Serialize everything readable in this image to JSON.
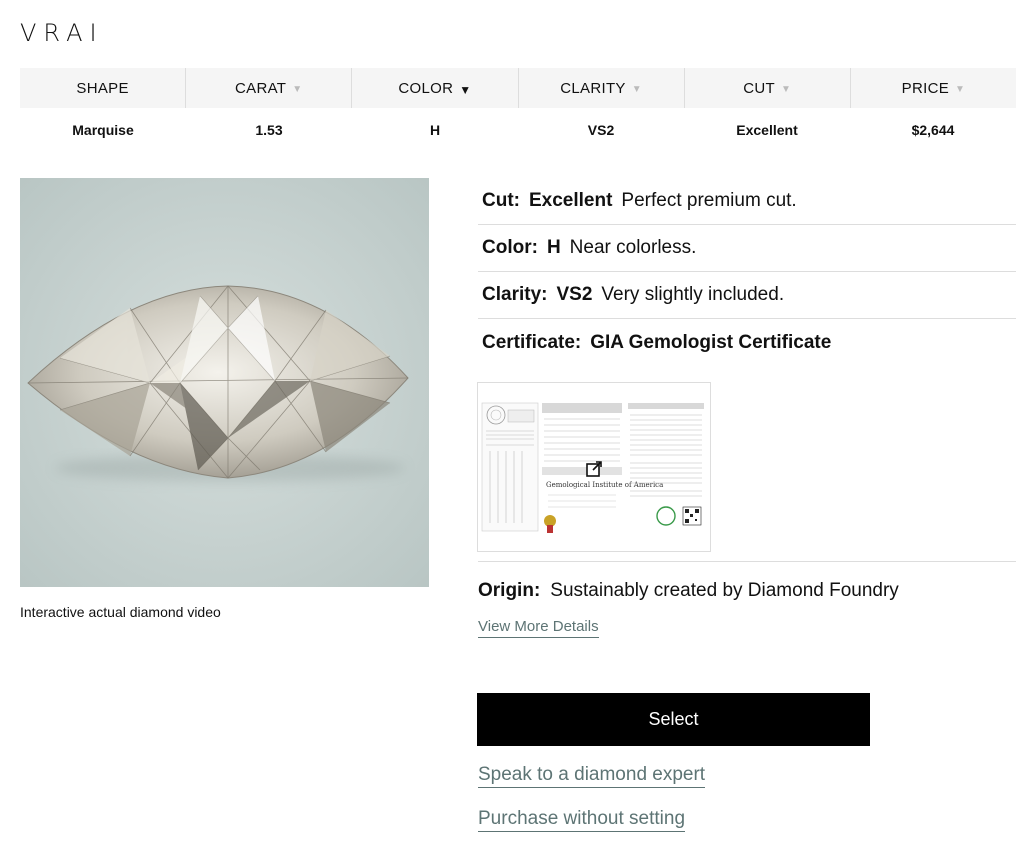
{
  "brand": {
    "logo_text": "VRAI"
  },
  "filters": {
    "headers": [
      {
        "label": "SHAPE",
        "arrow": "",
        "active": false
      },
      {
        "label": "CARAT",
        "arrow": "▼",
        "active": false
      },
      {
        "label": "COLOR",
        "arrow": "▼",
        "active": true
      },
      {
        "label": "CLARITY",
        "arrow": "▼",
        "active": false
      },
      {
        "label": "CUT",
        "arrow": "▼",
        "active": false
      },
      {
        "label": "PRICE",
        "arrow": "▼",
        "active": false
      }
    ]
  },
  "diamond_row": {
    "shape": "Marquise",
    "carat": "1.53",
    "color": "H",
    "clarity": "VS2",
    "cut": "Excellent",
    "price": "$2,644"
  },
  "media": {
    "caption": "Interactive actual diamond video"
  },
  "specs": {
    "cut": {
      "label": "Cut:",
      "value": "Excellent",
      "desc": "Perfect premium cut."
    },
    "color": {
      "label": "Color:",
      "value": "H",
      "desc": "Near colorless."
    },
    "clarity": {
      "label": "Clarity:",
      "value": "VS2",
      "desc": "Very slightly included."
    },
    "certificate": {
      "label": "Certificate:",
      "value": "GIA Gemologist Certificate"
    }
  },
  "origin": {
    "label": "Origin:",
    "value": "Sustainably created by Diamond Foundry"
  },
  "actions": {
    "view_more": "View More Details",
    "select": "Select",
    "speak_expert": "Speak to a diamond expert",
    "purchase_without_setting": "Purchase without setting"
  },
  "colors": {
    "header_bg": "#f5f5f5",
    "link": "#5d7474",
    "button_bg": "#000000",
    "photo_bg": "#c7d2d0"
  },
  "icons": {
    "certificate_open": "external-link-icon"
  }
}
